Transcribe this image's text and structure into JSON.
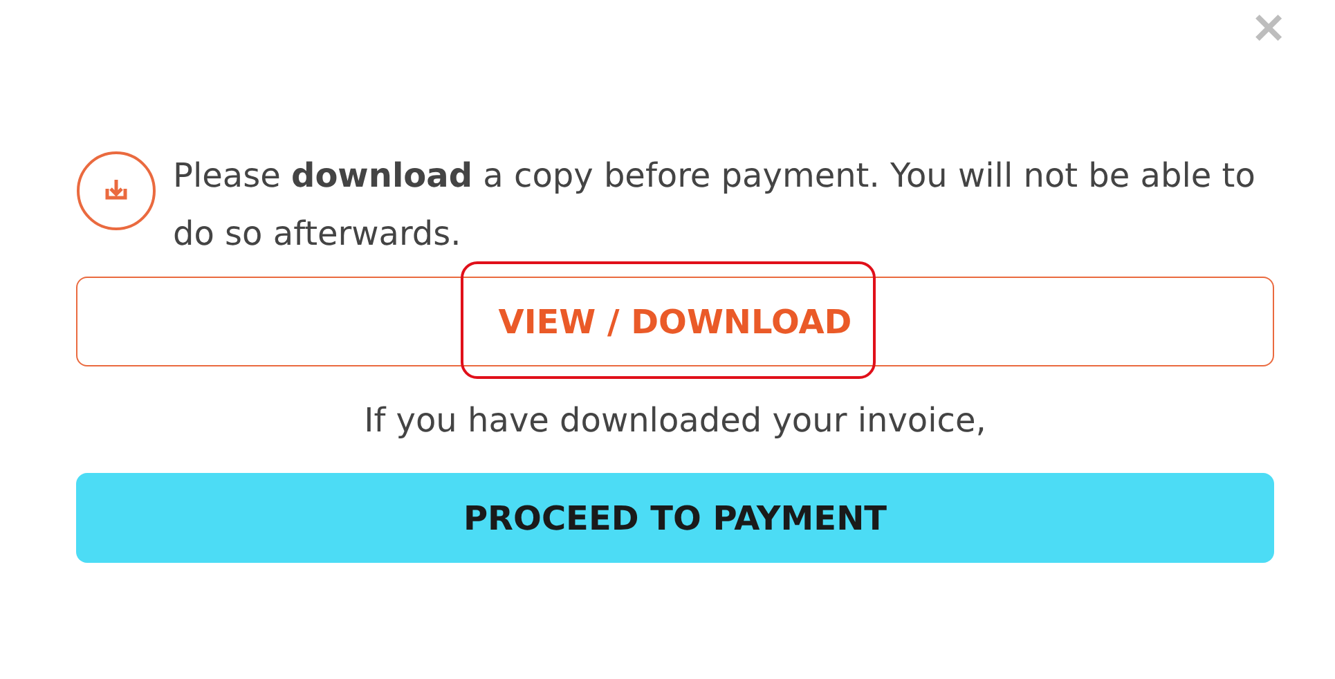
{
  "close": {
    "label": "✕"
  },
  "notice": {
    "text": "Please **download** a copy before payment. You will not be able to do so afterwards."
  },
  "download_button": {
    "label": "VIEW / DOWNLOAD",
    "highlighted": true
  },
  "prompt": "If you have downloaded your invoice,",
  "payment_button": {
    "label": "PROCEED TO PAYMENT"
  }
}
